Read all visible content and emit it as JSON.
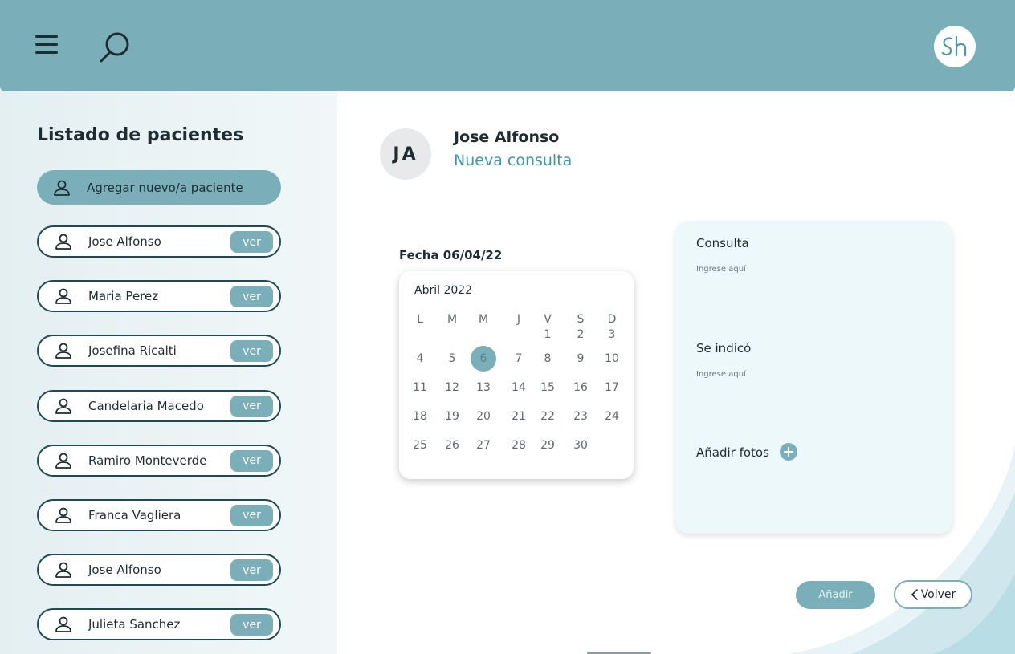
{
  "header": {
    "menu_icon": "hamburger-menu-icon",
    "search_icon": "search-icon",
    "logo_alt": "Sh"
  },
  "sidebar": {
    "title": "Listado de pacientes",
    "add_button_label": "Agregar nuevo/a paciente",
    "view_label": "ver",
    "patients": [
      {
        "name": "Jose Alfonso"
      },
      {
        "name": "Maria Perez"
      },
      {
        "name": "Josefina Ricalti"
      },
      {
        "name": "Candelaria Macedo"
      },
      {
        "name": "Ramiro Monteverde"
      },
      {
        "name": "Franca Vagliera"
      },
      {
        "name": "Jose Alfonso"
      },
      {
        "name": "Julieta Sanchez"
      }
    ]
  },
  "patient": {
    "initials": "JA",
    "name": "Jose Alfonso",
    "subtitle": "Nueva consulta"
  },
  "date": {
    "label": "Fecha 06/04/22",
    "calendar": {
      "month_label": "Abril 2022",
      "weekdays": [
        "L",
        "M",
        "M",
        "J",
        "V",
        "S",
        "D"
      ],
      "first_weekday_index": 4,
      "days_in_month": 30,
      "selected_day": 6
    }
  },
  "form": {
    "consulta_label": "Consulta",
    "consulta_placeholder": "Ingrese aquí",
    "indicacion_label": "Se indicó",
    "indicacion_placeholder": "Ingrese aquí",
    "photos_label": "Añadir fotos"
  },
  "actions": {
    "add_label": "Añadir",
    "back_label": "Volver"
  },
  "colors": {
    "primary": "#7aafba",
    "accent_text": "#3a97a7",
    "dark": "#1e2d33",
    "card_bg": "#edf8fa"
  }
}
